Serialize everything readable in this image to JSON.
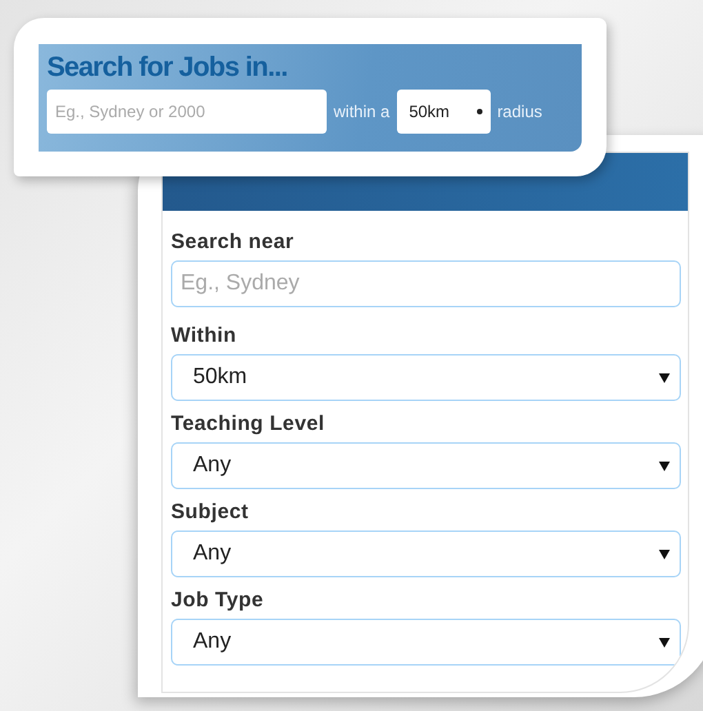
{
  "banner": {
    "title": "Search for Jobs in...",
    "location": {
      "placeholder": "Eg., Sydney or 2000"
    },
    "within_label": "within a",
    "radius": {
      "value": "50km"
    },
    "radius_label": "radius"
  },
  "search_panel": {
    "fields": [
      {
        "kind": "input",
        "label": "Search near",
        "placeholder": "Eg., Sydney"
      },
      {
        "kind": "select",
        "label": "Within",
        "value": "50km"
      },
      {
        "kind": "select",
        "label": "Teaching Level",
        "value": "Any"
      },
      {
        "kind": "select",
        "label": "Subject",
        "value": "Any"
      },
      {
        "kind": "select",
        "label": "Job Type",
        "value": "Any"
      }
    ]
  }
}
